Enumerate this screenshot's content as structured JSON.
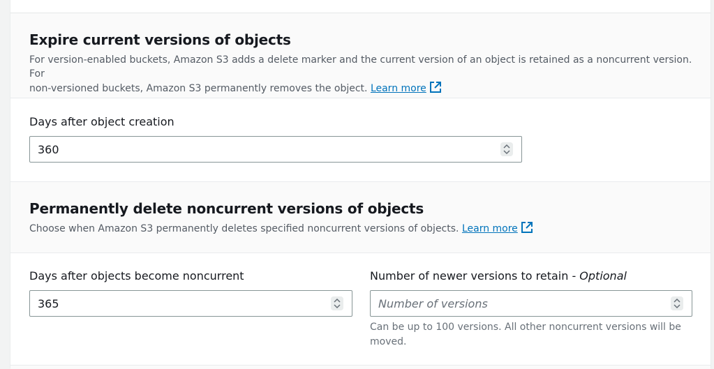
{
  "expire": {
    "title": "Expire current versions of objects",
    "desc_line1": "For version-enabled buckets, Amazon S3 adds a delete marker and the current version of an object is retained as a noncurrent version. For",
    "desc_line2": "non-versioned buckets, Amazon S3 permanently removes the object.",
    "learn_more": "Learn more",
    "days_label": "Days after object creation",
    "days_value": "360"
  },
  "permanent": {
    "title": "Permanently delete noncurrent versions of objects",
    "desc": "Choose when Amazon S3 permanently deletes specified noncurrent versions of objects.",
    "learn_more": "Learn more",
    "days_label": "Days after objects become noncurrent",
    "days_value": "365",
    "versions_label": "Number of newer versions to retain - ",
    "versions_label_optional": "Optional",
    "versions_placeholder": "Number of versions",
    "versions_hint": "Can be up to 100 versions. All other noncurrent versions will be moved."
  },
  "colors": {
    "link": "#0073bb",
    "border": "#879596",
    "header_bg": "#fafafa"
  },
  "icons": {
    "external_link": "external-link-icon",
    "spinner": "number-spinner-icon"
  }
}
